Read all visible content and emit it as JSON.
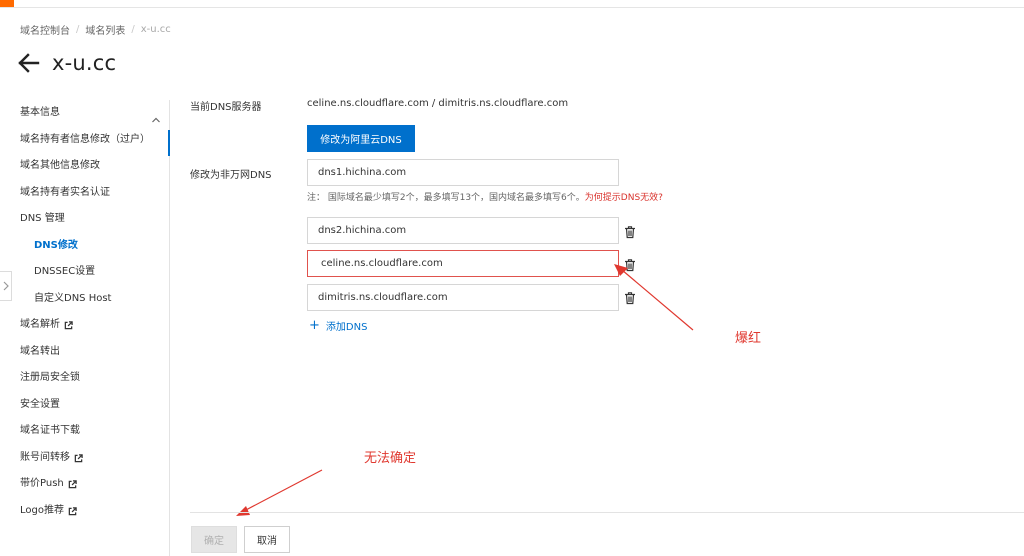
{
  "theme": {
    "accent": "#0070cc",
    "brand_orange": "#ff6a00",
    "error": "#e0524d",
    "annotation": "#e0382f"
  },
  "breadcrumb": [
    "域名控制台",
    "域名列表",
    "x-u.cc"
  ],
  "page": {
    "title": "x-u.cc"
  },
  "sidebar": {
    "items": [
      {
        "label": "基本信息",
        "external": false
      },
      {
        "label": "域名持有者信息修改（过户）",
        "external": false
      },
      {
        "label": "域名其他信息修改",
        "external": false
      },
      {
        "label": "域名持有者实名认证",
        "external": false
      },
      {
        "label": "DNS 管理",
        "external": false,
        "expanded": true
      },
      {
        "label": "DNS修改",
        "external": false,
        "active": true
      },
      {
        "label": "DNSSEC设置",
        "external": false
      },
      {
        "label": "自定义DNS Host",
        "external": false
      },
      {
        "label": "域名解析",
        "external": true
      },
      {
        "label": "域名转出",
        "external": false
      },
      {
        "label": "注册局安全锁",
        "external": false
      },
      {
        "label": "安全设置",
        "external": false
      },
      {
        "label": "域名证书下载",
        "external": false
      },
      {
        "label": "账号间转移",
        "external": true
      },
      {
        "label": "带价Push",
        "external": true
      },
      {
        "label": "Logo推荐",
        "external": true
      }
    ]
  },
  "form": {
    "current_dns_label": "当前DNS服务器",
    "current_dns_value": "celine.ns.cloudflare.com / dimitris.ns.cloudflare.com",
    "switch_button": "修改为阿里云DNS",
    "modify_label": "修改为非万网DNS",
    "dns_inputs": [
      "dns1.hichina.com",
      "dns2.hichina.com",
      "celine.ns.cloudflare.com",
      "dimitris.ns.cloudflare.com"
    ],
    "error_input_index": 2,
    "hint_prefix": "注：  国际域名最少填写2个，最多填写13个，国内域名最多填写6个。",
    "hint_link": "为何提示DNS无效?",
    "add_dns": "添加DNS"
  },
  "annotations": {
    "red_border": "爆红",
    "cannot_confirm": "无法确定"
  },
  "footer": {
    "confirm": "确定",
    "cancel": "取消"
  },
  "icons": {
    "back": "arrow-left-icon",
    "trash": "trash-icon",
    "external": "external-link-icon",
    "caret": "chevron-up-icon",
    "collapse": "chevron-right-icon"
  }
}
